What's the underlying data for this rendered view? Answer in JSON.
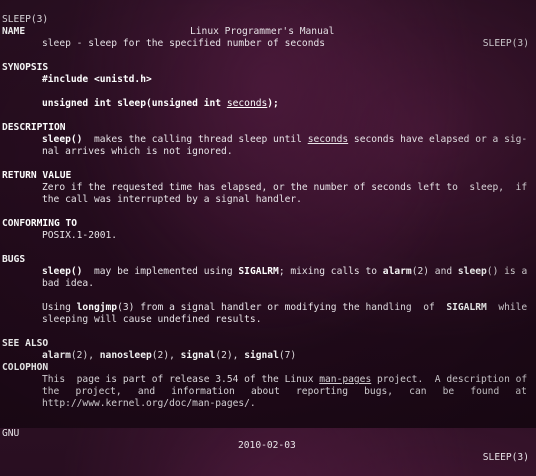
{
  "header": {
    "left": "SLEEP(3)",
    "center": "Linux Programmer's Manual",
    "right": "SLEEP(3)"
  },
  "name": {
    "heading": "NAME",
    "text": "sleep - sleep for the specified number of seconds"
  },
  "synopsis": {
    "heading": "SYNOPSIS",
    "include": "#include <unistd.h>",
    "proto_prefix": "unsigned int sleep(unsigned int ",
    "proto_arg": "seconds",
    "proto_suffix": ");"
  },
  "description": {
    "heading": "DESCRIPTION",
    "fn": "sleep()",
    "line1_mid": "  makes the calling thread sleep until ",
    "line1_arg": "seconds",
    "line1_end": " seconds have elapsed or a sig-",
    "line2": "nal arrives which is not ignored."
  },
  "return_value": {
    "heading": "RETURN VALUE",
    "line1": "Zero if the requested time has elapsed, or the number of seconds left to  sleep,  if",
    "line2": "the call was interrupted by a signal handler."
  },
  "conforming": {
    "heading": "CONFORMING TO",
    "text": "POSIX.1-2001."
  },
  "bugs": {
    "heading": "BUGS",
    "p1_fn": "sleep()",
    "p1_a": "  may be implemented using ",
    "p1_sig": "SIGALRM",
    "p1_b": "; mixing calls to ",
    "p1_alarm": "alarm",
    "p1_c": "(2) and ",
    "p1_sleep": "sleep",
    "p1_d": "() is a",
    "p1_line2": "bad idea.",
    "p2_a": "Using ",
    "p2_longjmp": "longjmp",
    "p2_b": "(3) from a signal handler or modifying the handling  of  ",
    "p2_sig": "SIGALRM",
    "p2_c": "  while",
    "p2_line2": "sleeping will cause undefined results."
  },
  "see_also": {
    "heading": "SEE ALSO",
    "items": [
      {
        "name": "alarm",
        "sect": "(2)"
      },
      {
        "name": "nanosleep",
        "sect": "(2)"
      },
      {
        "name": "signal",
        "sect": "(2)"
      },
      {
        "name": "signal",
        "sect": "(7)"
      }
    ],
    "sep": ", "
  },
  "colophon": {
    "heading": "COLOPHON",
    "l1_a": "This  page is part of release 3.54 of the Linux ",
    "l1_link": "man-pages",
    "l1_b": " project.  A description of",
    "l2_words": [
      "the",
      "project,",
      "and",
      "information",
      "about",
      "reporting",
      "bugs,",
      "can",
      "be",
      "found",
      "at"
    ],
    "l3": "http://www.kernel.org/doc/man-pages/."
  },
  "footer": {
    "left": "GNU",
    "center": "2010-02-03",
    "right": "SLEEP(3)"
  }
}
